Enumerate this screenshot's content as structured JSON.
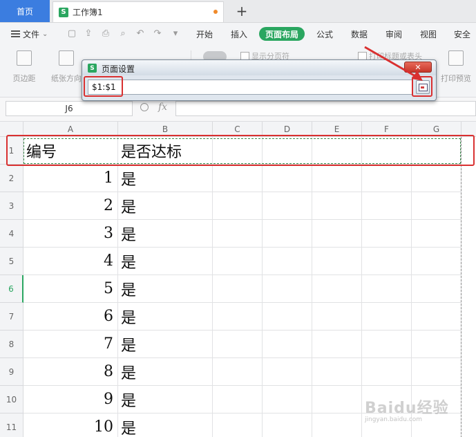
{
  "tabs": {
    "home": "首页",
    "doc": "工作簿1",
    "add": "+"
  },
  "menu": {
    "file": "文件",
    "items": [
      "开始",
      "插入",
      "页面布局",
      "公式",
      "数据",
      "审阅",
      "视图",
      "安全"
    ],
    "active": "页面布局"
  },
  "ribbon": {
    "margins": "页边距",
    "orientation": "纸张方向",
    "show_page_breaks": "显示分页符",
    "print_titles": "打印标题或表头",
    "print_preview": "打印预览"
  },
  "formula_bar": {
    "name_box": "J6",
    "fx": "fx",
    "value": ""
  },
  "grid": {
    "columns": [
      "A",
      "B",
      "C",
      "D",
      "E",
      "F",
      "G"
    ],
    "rows": [
      {
        "n": "1",
        "a": "编号",
        "b": "是否达标"
      },
      {
        "n": "2",
        "a": "1",
        "b": "是"
      },
      {
        "n": "3",
        "a": "2",
        "b": "是"
      },
      {
        "n": "4",
        "a": "3",
        "b": "是"
      },
      {
        "n": "5",
        "a": "4",
        "b": "是"
      },
      {
        "n": "6",
        "a": "5",
        "b": "是"
      },
      {
        "n": "7",
        "a": "6",
        "b": "是"
      },
      {
        "n": "8",
        "a": "7",
        "b": "是"
      },
      {
        "n": "9",
        "a": "8",
        "b": "是"
      },
      {
        "n": "10",
        "a": "9",
        "b": "是"
      },
      {
        "n": "11",
        "a": "10",
        "b": "是"
      }
    ],
    "active_row": "6"
  },
  "dialog": {
    "title": "页面设置",
    "range_value": "$1:$1",
    "close": "✕"
  },
  "watermark": {
    "brand": "Baidu经验",
    "url": "jingyan.baidu.com"
  },
  "colors": {
    "accent_green": "#2aa660",
    "home_tab_blue": "#3b7de0",
    "annotation_red": "#d93030"
  }
}
